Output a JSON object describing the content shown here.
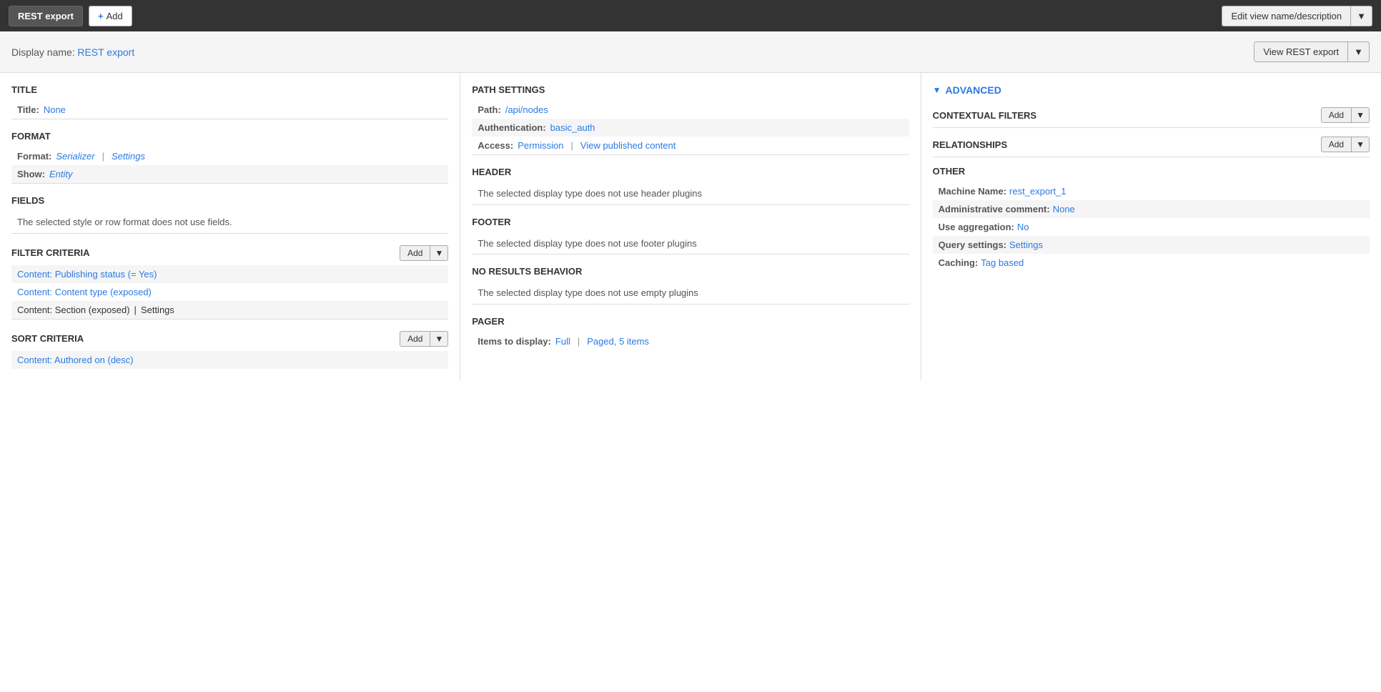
{
  "toolbar": {
    "rest_export_label": "REST export",
    "add_label": "Add",
    "edit_name_label": "Edit view name/description",
    "dropdown_arrow": "▼"
  },
  "display_name_bar": {
    "label": "Display name:",
    "value": "REST export",
    "view_button_label": "View REST export"
  },
  "col1": {
    "title_section": "TITLE",
    "title_label": "Title:",
    "title_value": "None",
    "format_section": "FORMAT",
    "format_label": "Format:",
    "format_value": "Serializer",
    "format_sep": "|",
    "format_settings": "Settings",
    "show_label": "Show:",
    "show_value": "Entity",
    "fields_section": "FIELDS",
    "fields_text": "The selected style or row format does not use fields.",
    "filter_criteria_section": "FILTER CRITERIA",
    "filter_add_label": "Add",
    "filter_items": [
      {
        "text": "Content: Publishing status (= Yes)",
        "shaded": true
      },
      {
        "text": "Content: Content type (exposed)",
        "shaded": false
      },
      {
        "text": "Content: Section (exposed)",
        "shaded": true,
        "has_settings": true,
        "settings_label": "Settings"
      }
    ],
    "sort_criteria_section": "SORT CRITERIA",
    "sort_add_label": "Add",
    "sort_items": [
      {
        "text": "Content: Authored on (desc)",
        "shaded": true
      }
    ]
  },
  "col2": {
    "path_section": "PATH SETTINGS",
    "path_label": "Path:",
    "path_value": "/api/nodes",
    "auth_label": "Authentication:",
    "auth_value": "basic_auth",
    "access_label": "Access:",
    "access_value": "Permission",
    "access_sep": "|",
    "access_link": "View published content",
    "header_section": "HEADER",
    "header_text": "The selected display type does not use header plugins",
    "footer_section": "FOOTER",
    "footer_text": "The selected display type does not use footer plugins",
    "no_results_section": "NO RESULTS BEHAVIOR",
    "no_results_text": "The selected display type does not use empty plugins",
    "pager_section": "PAGER",
    "pager_items_label": "Items to display:",
    "pager_full_value": "Full",
    "pager_sep": "|",
    "pager_paged_value": "Paged, 5 items"
  },
  "col3": {
    "advanced_label": "ADVANCED",
    "contextual_filters_section": "CONTEXTUAL FILTERS",
    "contextual_add_label": "Add",
    "relationships_section": "RELATIONSHIPS",
    "relationships_add_label": "Add",
    "other_section": "OTHER",
    "machine_name_label": "Machine Name:",
    "machine_name_value": "rest_export_1",
    "admin_comment_label": "Administrative comment:",
    "admin_comment_value": "None",
    "use_aggregation_label": "Use aggregation:",
    "use_aggregation_value": "No",
    "query_settings_label": "Query settings:",
    "query_settings_value": "Settings",
    "caching_label": "Caching:",
    "caching_value": "Tag based"
  }
}
